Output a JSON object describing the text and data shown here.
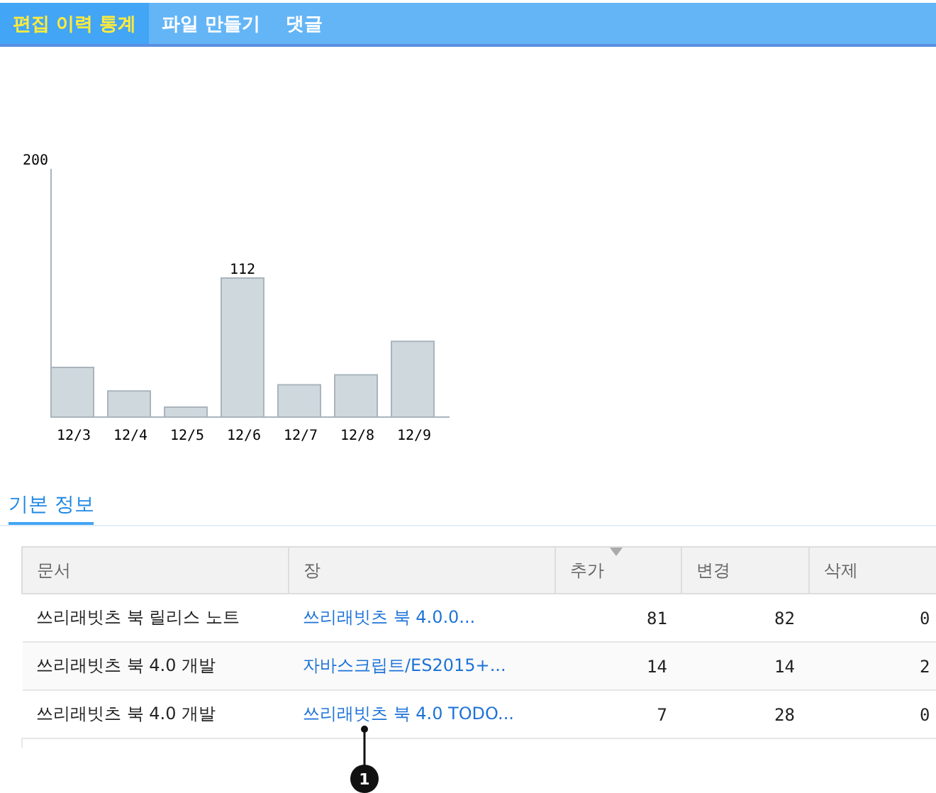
{
  "tabs": [
    {
      "label": "편집 이력 통계",
      "selected": true
    },
    {
      "label": "파일 만들기",
      "selected": false
    },
    {
      "label": "댓글",
      "selected": false
    }
  ],
  "chart": {
    "chart_data": {
      "type": "bar",
      "categories": [
        "12/3",
        "12/4",
        "12/5",
        "12/6",
        "12/7",
        "12/8",
        "12/9"
      ],
      "values": [
        40,
        21,
        8,
        112,
        26,
        34,
        61
      ],
      "annotations": [
        "200"
      ],
      "value_labels": [
        null,
        null,
        null,
        "112",
        null,
        null,
        null
      ]
    }
  },
  "section": {
    "title": "기본 정보"
  },
  "table": {
    "columns": [
      {
        "label": "문서",
        "sorted": false
      },
      {
        "label": "장",
        "sorted": false
      },
      {
        "label": "추가",
        "sorted": true
      },
      {
        "label": "변경",
        "sorted": false
      },
      {
        "label": "삭제",
        "sorted": false
      }
    ],
    "rows": [
      {
        "document": "쓰리래빗츠 북 릴리스 노트",
        "chapter": "쓰리래빗츠 북 4.0.0...",
        "added": "81",
        "changed": "82",
        "deleted": "0"
      },
      {
        "document": "쓰리래빗츠 북 4.0 개발",
        "chapter": "자바스크립트/ES2015+...",
        "added": "14",
        "changed": "14",
        "deleted": "2"
      },
      {
        "document": "쓰리래빗츠 북 4.0 개발",
        "chapter": "쓰리래빗츠 북 4.0 TODO...",
        "added": "7",
        "changed": "28",
        "deleted": "0"
      }
    ]
  },
  "callouts": [
    {
      "label": "1"
    }
  ]
}
